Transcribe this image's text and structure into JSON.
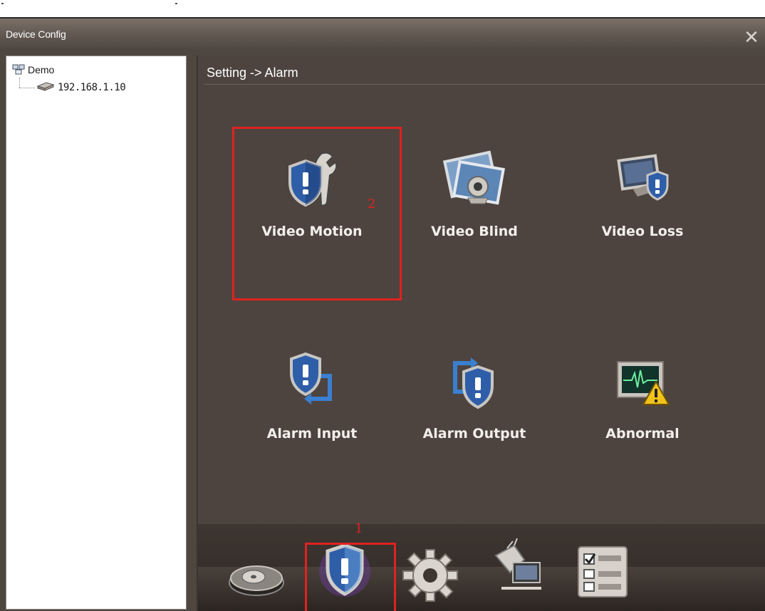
{
  "window": {
    "title": "Device Config",
    "close_glyph": "✕"
  },
  "tree": {
    "root_label": "Demo",
    "root_icon": "network-group-icon",
    "child_label": "192.168.1.10",
    "child_icon": "dvr-device-icon"
  },
  "main": {
    "breadcrumb": "Setting -> Alarm",
    "tiles": [
      {
        "label": "Video Motion",
        "icon": "shield-wrench-icon"
      },
      {
        "label": "Video Blind",
        "icon": "photo-camera-icon"
      },
      {
        "label": "Video Loss",
        "icon": "monitor-shield-icon"
      },
      {
        "label": "Alarm Input",
        "icon": "shield-arrow-in-icon"
      },
      {
        "label": "Alarm Output",
        "icon": "shield-arrow-out-icon"
      },
      {
        "label": "Abnormal",
        "icon": "monitor-warning-icon"
      }
    ]
  },
  "bottom_toolbar": {
    "items": [
      {
        "icon": "hard-disk-icon"
      },
      {
        "icon": "alarm-shield-icon",
        "selected": true
      },
      {
        "icon": "gear-icon"
      },
      {
        "icon": "network-computer-icon"
      },
      {
        "icon": "checklist-icon"
      }
    ]
  },
  "annotations": {
    "step1": "1",
    "step2": "2",
    "color": "#e0221f"
  },
  "colors": {
    "panel_bg": "#4e443f",
    "shield_blue": "#2f5ea8",
    "highlight": "#e0221f"
  }
}
